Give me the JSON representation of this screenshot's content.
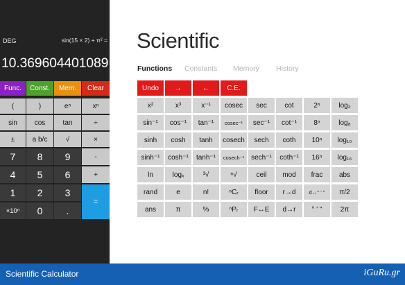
{
  "display": {
    "mode": "DEG",
    "expression": "sin(15 × 2) + π² =",
    "result": "10.369604401089"
  },
  "category_buttons": [
    "Func.",
    "Const.",
    "Mem.",
    "Clear"
  ],
  "basic_keys": [
    "(",
    ")",
    "eⁿ",
    "xⁿ",
    "sin",
    "cos",
    "tan",
    "÷",
    "±",
    "a b/c",
    "√",
    "×",
    "7",
    "8",
    "9",
    "-",
    "4",
    "5",
    "6",
    "+",
    "1",
    "2",
    "3",
    "×10ⁿ",
    "0",
    ".",
    "="
  ],
  "panel": {
    "title": "Scientific",
    "tabs": [
      "Functions",
      "Constants",
      "Memory",
      "History"
    ],
    "active_tab": "Functions"
  },
  "action_buttons": [
    "Undo",
    "→",
    "←",
    "C.E."
  ],
  "function_keys": [
    [
      "x²",
      "x³",
      "x⁻¹",
      "cosec",
      "sec",
      "cot",
      "2ⁿ",
      "log₂"
    ],
    [
      "sin⁻¹",
      "cos⁻¹",
      "tan⁻¹",
      "cosec⁻¹",
      "sec⁻¹",
      "cot⁻¹",
      "8ⁿ",
      "log₈"
    ],
    [
      "sinh",
      "cosh",
      "tanh",
      "cosech",
      "sech",
      "coth",
      "10ⁿ",
      "log₁₀"
    ],
    [
      "sinh⁻¹",
      "cosh⁻¹",
      "tanh⁻¹",
      "cosech⁻¹",
      "sech⁻¹",
      "coth⁻¹",
      "16ⁿ",
      "log₁₆"
    ],
    [
      "ln",
      "logₓ",
      "³√",
      "ⁿ√",
      "ceil",
      "mod",
      "frac",
      "abs"
    ],
    [
      "rand",
      "e",
      "n!",
      "ⁿCᵣ",
      "floor",
      "r→d",
      "d↔° ' \"",
      "π/2"
    ],
    [
      "ans",
      "π",
      "%",
      "ⁿPᵣ",
      "F↔E",
      "d→r",
      "° ' \"",
      "2π"
    ]
  ],
  "footer": {
    "app_name": "Scientific Calculator",
    "logo_text": "iGuRu.gr"
  },
  "colors": {
    "func": "#8b22c4",
    "const": "#4ca22b",
    "mem": "#e8900f",
    "clear": "#d52a18",
    "equals": "#1e9de3",
    "action": "#e31a1a",
    "footer": "#1660b3"
  }
}
